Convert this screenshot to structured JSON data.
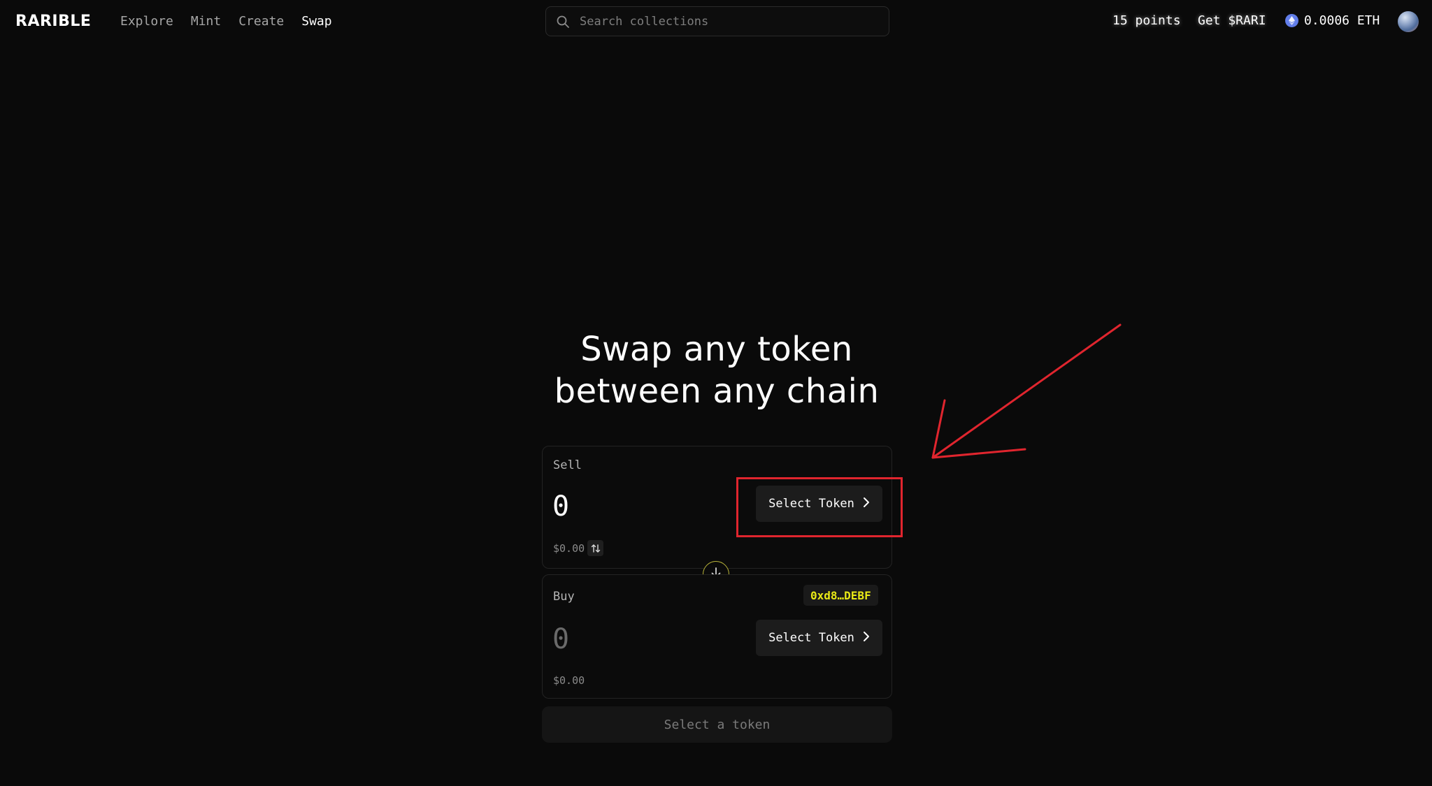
{
  "nav": {
    "logo": "RARIBLE",
    "links": [
      {
        "label": "Explore"
      },
      {
        "label": "Mint"
      },
      {
        "label": "Create"
      },
      {
        "label": "Swap"
      }
    ],
    "active_link": "Swap",
    "search": {
      "placeholder": "Search collections",
      "icon": "search-icon"
    },
    "points": "15 points",
    "get_rari": "Get $RARI",
    "balance": {
      "icon": "eth-icon",
      "text": "0.0006 ETH"
    }
  },
  "hero": {
    "line1": "Swap any token",
    "line2": "between any chain"
  },
  "sell": {
    "label": "Sell",
    "amount": "0",
    "usd": "$0.00",
    "select_label": "Select Token",
    "flip_icon": "swap-vertical-icon"
  },
  "buy": {
    "label": "Buy",
    "amount": "0",
    "usd": "$0.00",
    "select_label": "Select Token",
    "address": "0xd8…DEBF"
  },
  "switch_icon": "arrow-down-icon",
  "cta_label": "Select a token",
  "colors": {
    "background": "#0a0a0a",
    "accent_yellow": "#e8e816",
    "annotation_red": "#e0252e",
    "eth_blue": "#627eea"
  }
}
